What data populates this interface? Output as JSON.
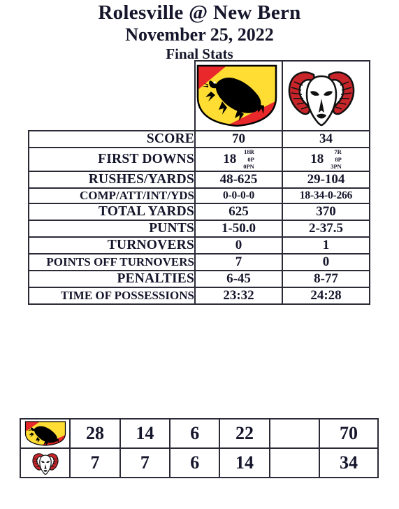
{
  "header": {
    "matchup": "Rolesville @ New Bern",
    "date": "November 25, 2022",
    "subtitle": "Final Stats"
  },
  "teams": {
    "home": {
      "logo": "bern-bear-crest-icon"
    },
    "away": {
      "logo": "ram-head-icon"
    }
  },
  "colors": {
    "crest_red": "#e8282a",
    "crest_yellow": "#ffdd33",
    "crest_black": "#000000",
    "ram_red": "#c8252b",
    "text": "#15152b",
    "border": "#2b2b38"
  },
  "stats": {
    "rows": [
      {
        "label": "SCORE",
        "home": "70",
        "away": "34",
        "size": "big"
      },
      {
        "label": "FIRST DOWNS",
        "home": "18",
        "away": "18",
        "size": "big",
        "home_breakdown": [
          "18R",
          "0P",
          "0PN"
        ],
        "away_breakdown": [
          "7R",
          "8P",
          "3PN"
        ]
      },
      {
        "label": "RUSHES/YARDS",
        "home": "48-625",
        "away": "29-104",
        "size": "big"
      },
      {
        "label": "COMP/ATT/INT/YDS",
        "home": "0-0-0-0",
        "away": "18-34-0-266",
        "size": "tight"
      },
      {
        "label": "TOTAL YARDS",
        "home": "625",
        "away": "370",
        "size": "big"
      },
      {
        "label": "PUNTS",
        "home": "1-50.0",
        "away": "2-37.5",
        "size": "big"
      },
      {
        "label": "TURNOVERS",
        "home": "0",
        "away": "1",
        "size": "big"
      },
      {
        "label": "POINTS OFF TURNOVERS",
        "home": "7",
        "away": "0",
        "size": "big"
      },
      {
        "label": "PENALTIES",
        "home": "6-45",
        "away": "8-77",
        "size": "big"
      },
      {
        "label": "TIME OF POSSESSIONS",
        "home": "23:32",
        "away": "24:28",
        "size": "big"
      }
    ]
  },
  "linescore": {
    "rows": [
      {
        "logo": "bern-bear-crest-icon",
        "q1": "28",
        "q2": "14",
        "q3": "6",
        "q4": "22",
        "ot": "",
        "total": "70"
      },
      {
        "logo": "ram-head-icon",
        "q1": "7",
        "q2": "7",
        "q3": "6",
        "q4": "14",
        "ot": "",
        "total": "34"
      }
    ]
  }
}
